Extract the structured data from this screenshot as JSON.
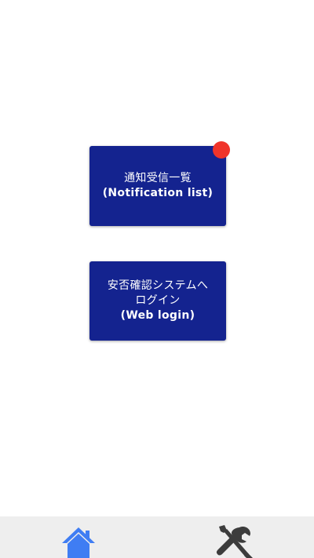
{
  "buttons": {
    "notification": {
      "line1": "通知受信一覧",
      "line2": "(Notification list)"
    },
    "login": {
      "line1": "安否確認システムへ",
      "line2": "ログイン",
      "line3": "(Web login)"
    }
  },
  "badge": {
    "color": "#f0342a"
  },
  "nav": {
    "items": [
      {
        "icon": "home-icon",
        "active": true,
        "color": "#3f7df3"
      },
      {
        "icon": "tools-icon",
        "active": false,
        "color": "#3c3c3c"
      }
    ]
  },
  "colors": {
    "button_bg": "#14238f",
    "button_text": "#ffffff",
    "nav_bg": "#eeeeee"
  }
}
